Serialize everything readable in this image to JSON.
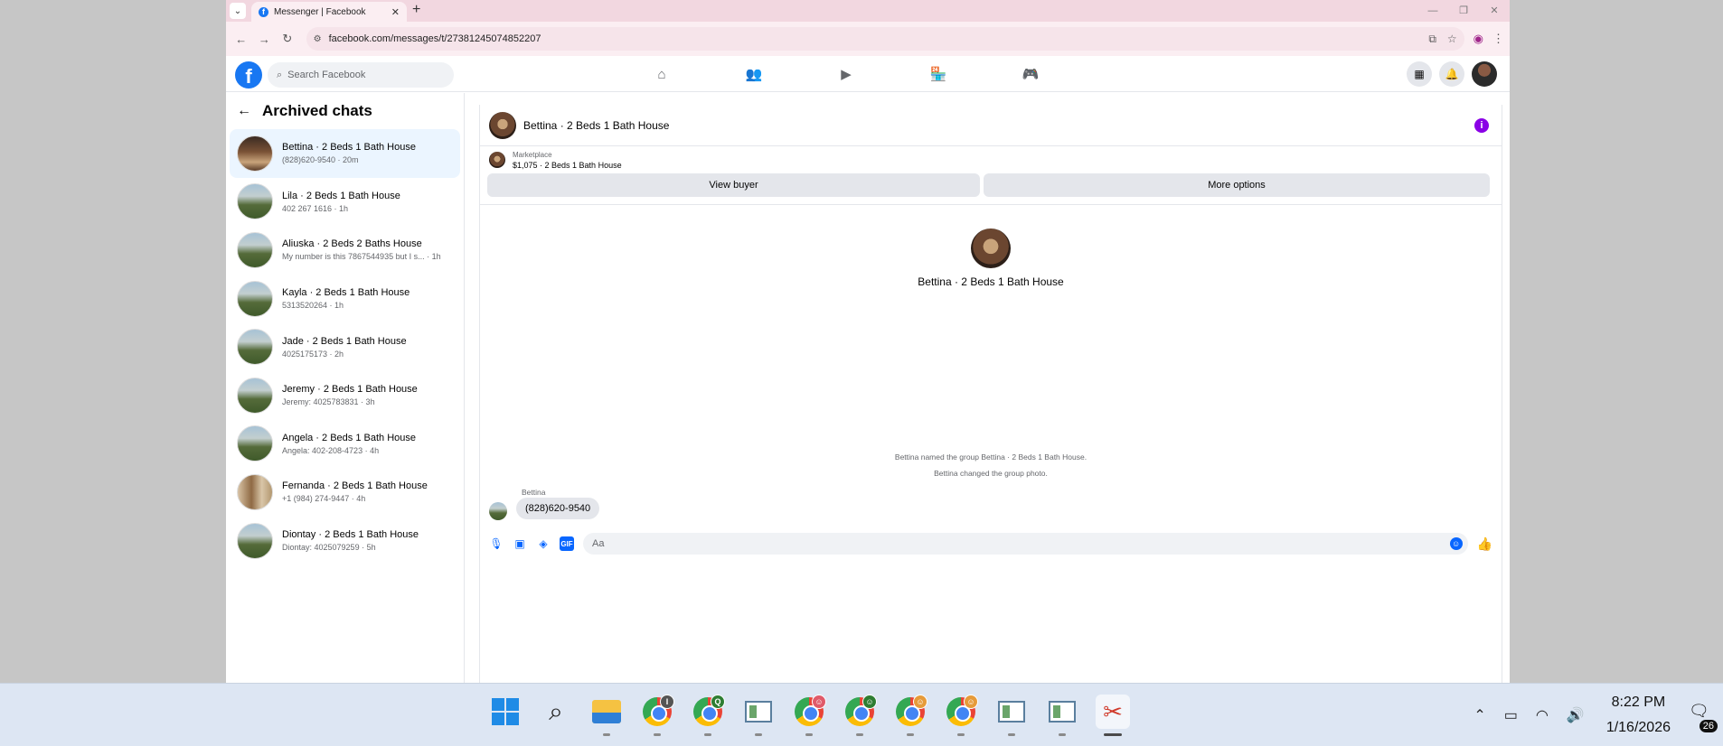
{
  "browser": {
    "tab_title": "Messenger | Facebook",
    "url": "facebook.com/messages/t/27381245074852207"
  },
  "fb": {
    "search_placeholder": "Search Facebook"
  },
  "sidebar": {
    "title": "Archived chats",
    "chats": [
      {
        "name": "Bettina · 2 Beds 1 Bath House",
        "preview": "(828)620-9540 · 20m",
        "thumb": "interior"
      },
      {
        "name": "Lila · 2 Beds 1 Bath House",
        "preview": "402 267 1616 · 1h",
        "thumb": "house"
      },
      {
        "name": "Aliuska · 2 Beds 2 Baths House",
        "preview": "My number is this 7867544935 but I s... · 1h",
        "thumb": "house"
      },
      {
        "name": "Kayla · 2 Beds 1 Bath House",
        "preview": "5313520264 · 1h",
        "thumb": "house"
      },
      {
        "name": "Jade · 2 Beds 1 Bath House",
        "preview": "4025175173 · 2h",
        "thumb": "house"
      },
      {
        "name": "Jeremy · 2 Beds 1 Bath House",
        "preview": "Jeremy: 4025783831 · 3h",
        "thumb": "house"
      },
      {
        "name": "Angela · 2 Beds 1 Bath House",
        "preview": "Angela: 402-208-4723 · 4h",
        "thumb": "house"
      },
      {
        "name": "Fernanda · 2 Beds 1 Bath House",
        "preview": "+1 (984) 274-9447 · 4h",
        "thumb": "wood"
      },
      {
        "name": "Diontay · 2 Beds 1 Bath House",
        "preview": "Diontay: 4025079259 · 5h",
        "thumb": "house"
      }
    ]
  },
  "conversation": {
    "title": "Bettina · 2 Beds 1 Bath House",
    "marketplace_label": "Marketplace",
    "listing": "$1,075 · 2 Beds 1 Bath House",
    "view_buyer": "View buyer",
    "more_options": "More options",
    "profile_name": "Bettina · 2 Beds 1 Bath House",
    "system_1": "Bettina named the group Bettina · 2 Beds 1 Bath House.",
    "system_2": "Bettina changed the group photo.",
    "sender": "Bettina",
    "message": "(828)620-9540",
    "composer_placeholder": "Aa"
  },
  "taskbar": {
    "time": "8:22 PM",
    "date": "1/16/2026",
    "notifications": "26",
    "apps": [
      {
        "name": "start",
        "badge": ""
      },
      {
        "name": "search",
        "badge": ""
      },
      {
        "name": "file-explorer",
        "badge": ""
      },
      {
        "name": "chrome-profile-I",
        "badge": "I",
        "badge_color": "#555555"
      },
      {
        "name": "chrome-profile-Q",
        "badge": "Q",
        "badge_color": "#2e7d32"
      },
      {
        "name": "spreadsheet",
        "badge": ""
      },
      {
        "name": "chrome-profile-red",
        "badge": "☺",
        "badge_color": "#e05a6a"
      },
      {
        "name": "chrome-profile-green",
        "badge": "☺",
        "badge_color": "#2e7d32"
      },
      {
        "name": "chrome-profile-orange",
        "badge": "☺",
        "badge_color": "#e69b3a"
      },
      {
        "name": "chrome-profile-orange-2",
        "badge": "☺",
        "badge_color": "#e69b3a"
      },
      {
        "name": "spreadsheet-2",
        "badge": ""
      },
      {
        "name": "spreadsheet-3",
        "badge": ""
      },
      {
        "name": "snipping-tool",
        "badge": ""
      }
    ]
  }
}
